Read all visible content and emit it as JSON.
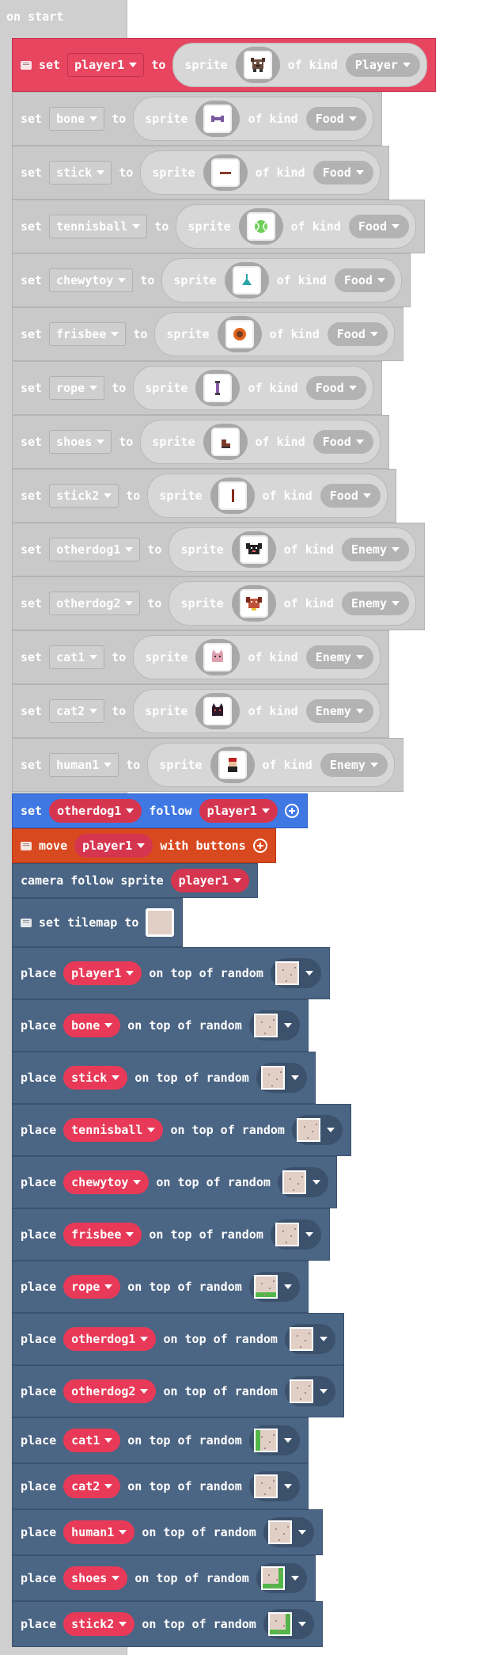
{
  "hat": {
    "label": "on start"
  },
  "kw": {
    "set": "set",
    "to": "to",
    "sprite": "sprite",
    "of_kind": "of kind",
    "follow": "follow",
    "move": "move",
    "with_buttons": "with buttons",
    "camera_follow": "camera follow sprite",
    "set_tilemap": "set tilemap to",
    "place": "place",
    "on_top": "on top of random"
  },
  "sprites": [
    {
      "var": "player1",
      "kind": "Player",
      "icon": "dog-player-icon",
      "color": "#6b4b3a"
    },
    {
      "var": "bone",
      "kind": "Food",
      "icon": "bone-icon",
      "color": "#7a5aa0"
    },
    {
      "var": "stick",
      "kind": "Food",
      "icon": "stick-icon",
      "color": "#8a3a2a"
    },
    {
      "var": "tennisball",
      "kind": "Food",
      "icon": "tennis-ball-icon",
      "color": "#6fd05a"
    },
    {
      "var": "chewytoy",
      "kind": "Food",
      "icon": "chewy-toy-icon",
      "color": "#2aa4a8"
    },
    {
      "var": "frisbee",
      "kind": "Food",
      "icon": "frisbee-icon",
      "color": "#e0641e"
    },
    {
      "var": "rope",
      "kind": "Food",
      "icon": "rope-icon",
      "color": "#8a5aa8"
    },
    {
      "var": "shoes",
      "kind": "Food",
      "icon": "shoe-icon",
      "color": "#7a3a2a"
    },
    {
      "var": "stick2",
      "kind": "Food",
      "icon": "stick-vertical-icon",
      "color": "#8a2a1a"
    },
    {
      "var": "otherdog1",
      "kind": "Enemy",
      "icon": "black-dog-icon",
      "color": "#222222"
    },
    {
      "var": "otherdog2",
      "kind": "Enemy",
      "icon": "brown-dog-icon",
      "color": "#c0503a"
    },
    {
      "var": "cat1",
      "kind": "Enemy",
      "icon": "pink-cat-icon",
      "color": "#e0a0b0"
    },
    {
      "var": "cat2",
      "kind": "Enemy",
      "icon": "dark-cat-icon",
      "color": "#2a1a2a"
    },
    {
      "var": "human1",
      "kind": "Enemy",
      "icon": "human-icon",
      "color": "#c02020"
    }
  ],
  "follow": {
    "who": "otherdog1",
    "target": "player1"
  },
  "move": {
    "who": "player1"
  },
  "camera": {
    "target": "player1"
  },
  "places": [
    {
      "var": "player1",
      "tile": "plain"
    },
    {
      "var": "bone",
      "tile": "plain"
    },
    {
      "var": "stick",
      "tile": "plain"
    },
    {
      "var": "tennisball",
      "tile": "plain"
    },
    {
      "var": "chewytoy",
      "tile": "plain"
    },
    {
      "var": "frisbee",
      "tile": "plain"
    },
    {
      "var": "rope",
      "tile": "grass"
    },
    {
      "var": "otherdog1",
      "tile": "plain"
    },
    {
      "var": "otherdog2",
      "tile": "plain"
    },
    {
      "var": "cat1",
      "tile": "grass-side"
    },
    {
      "var": "cat2",
      "tile": "plain"
    },
    {
      "var": "human1",
      "tile": "plain"
    },
    {
      "var": "shoes",
      "tile": "grass-corner"
    },
    {
      "var": "stick2",
      "tile": "grass-corner"
    }
  ]
}
